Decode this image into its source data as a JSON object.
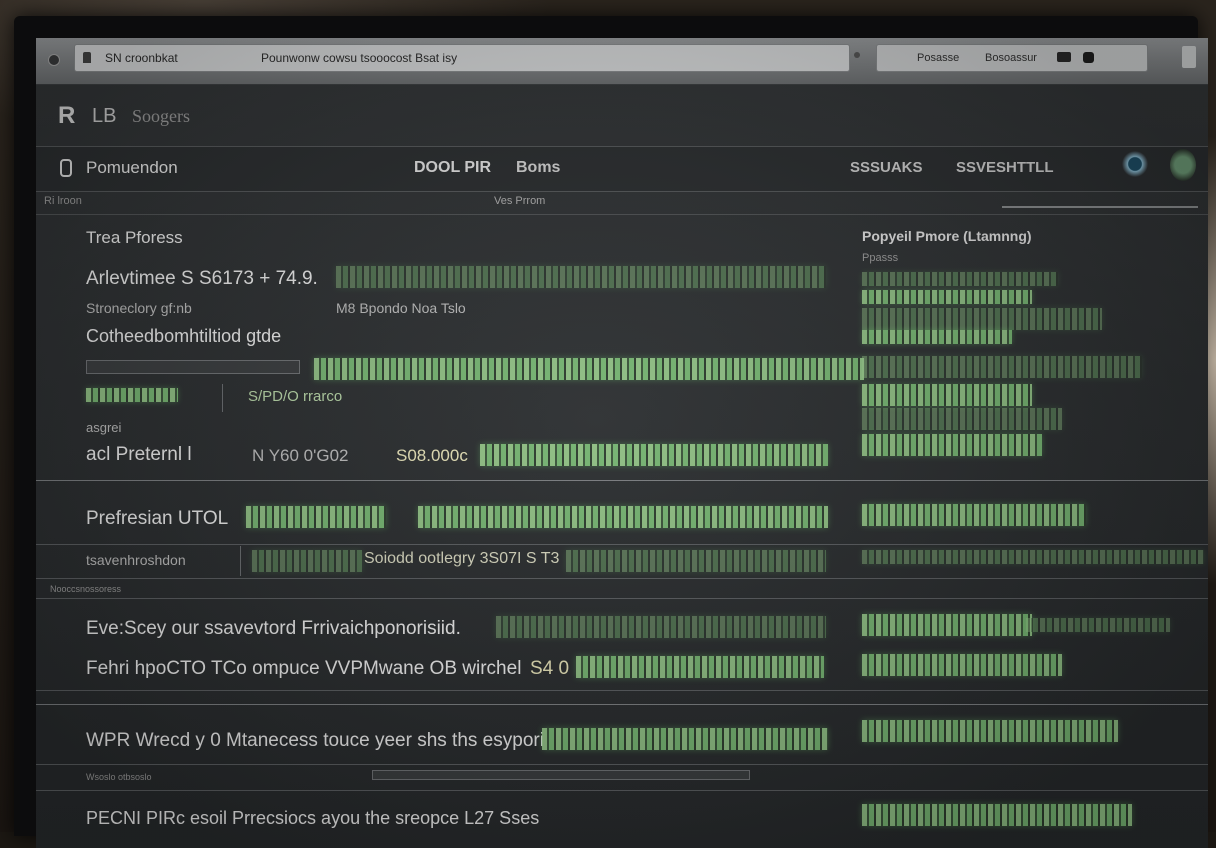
{
  "browser": {
    "site": "SN croonbkat",
    "page_title": "Pounwonw cowsu tsooocost Bsat isy",
    "search_text_1": "Posasse",
    "search_text_2": "Bosoassur"
  },
  "app": {
    "logo_mark": "R",
    "logo_text": "LB",
    "logo_name": "Soogers"
  },
  "nav": {
    "brand": "Pomuendon",
    "item_1": "DOOL PIR",
    "item_2": "Boms",
    "item_3": "SSSUAKS",
    "item_4": "SSVESHTTLL"
  },
  "subbar": {
    "left": "Ri lroon",
    "center": "Ves Prrom"
  },
  "section_1": {
    "title": "Trea Pforess",
    "line_1": "Arlevtimee S S6173  +  74.9.",
    "line_2_a": "Stroneclory gf:nb",
    "line_2_b": "M8 Bpondo  Noa Tslo",
    "line_3": "Cotheedbomhtiltiod gtde",
    "line_4_green": "S/PD/O rrarco",
    "line_5": "asgrei",
    "line_6_a": "acl Preternl l",
    "line_6_b": "N Y60 0'G02",
    "line_6_c": "S08.000c"
  },
  "side_panel": {
    "title": "Popyeil Pmore (Ltamnng)",
    "sub": "Ppasss"
  },
  "section_2": {
    "title": "Prefresian UTOL",
    "row_label": "tsavenhroshdon",
    "row_value": "Soiodd ootlegry  3S07I   S T3"
  },
  "section_3": {
    "tag": "Nooccsnossoress",
    "line_1": "Eve:Scey our ssavevtord Frrivaichponorisiid.",
    "line_2_a": "Fehri  hpoCTO TCo  ompuce  VVPMwane OB  wirchel",
    "line_2_b": "S4 0"
  },
  "section_4": {
    "line_1": "WPR Wrecd y 0 Mtanecess touce  yeer shs  ths esypori",
    "tag": "Wsoslo otbsoslo",
    "line_2": "PECNI PIRc esoil  Prrecsiocs  ayou the sreopce  L27 Sses"
  }
}
